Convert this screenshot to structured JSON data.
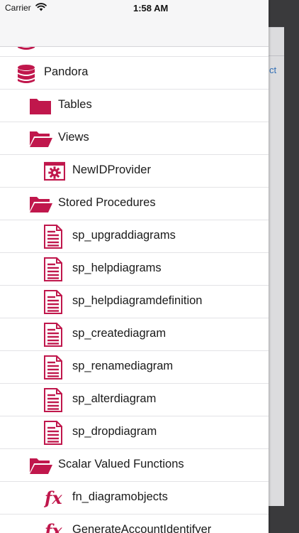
{
  "status_bar": {
    "carrier": "Carrier",
    "time": "1:58 AM"
  },
  "background": {
    "link_text": "ct"
  },
  "accent_color": "#c0174c",
  "tree": {
    "items": [
      {
        "label": "",
        "level": 0,
        "icon": "database-icon"
      },
      {
        "label": "Pandora",
        "level": 0,
        "icon": "database-icon"
      },
      {
        "label": "Tables",
        "level": 1,
        "icon": "folder-icon"
      },
      {
        "label": "Views",
        "level": 1,
        "icon": "folder-open-icon"
      },
      {
        "label": "NewIDProvider",
        "level": 2,
        "icon": "view-gear-icon"
      },
      {
        "label": "Stored Procedures",
        "level": 1,
        "icon": "folder-open-icon"
      },
      {
        "label": "sp_upgraddiagrams",
        "level": 2,
        "icon": "document-icon"
      },
      {
        "label": "sp_helpdiagrams",
        "level": 2,
        "icon": "document-icon"
      },
      {
        "label": "sp_helpdiagramdefinition",
        "level": 2,
        "icon": "document-icon"
      },
      {
        "label": "sp_creatediagram",
        "level": 2,
        "icon": "document-icon"
      },
      {
        "label": "sp_renamediagram",
        "level": 2,
        "icon": "document-icon"
      },
      {
        "label": "sp_alterdiagram",
        "level": 2,
        "icon": "document-icon"
      },
      {
        "label": "sp_dropdiagram",
        "level": 2,
        "icon": "document-icon"
      },
      {
        "label": "Scalar Valued Functions",
        "level": 1,
        "icon": "folder-open-icon"
      },
      {
        "label": "fn_diagramobjects",
        "level": 2,
        "icon": "function-icon"
      },
      {
        "label": "GenerateAccountIdentifyer",
        "level": 2,
        "icon": "function-icon"
      }
    ]
  }
}
